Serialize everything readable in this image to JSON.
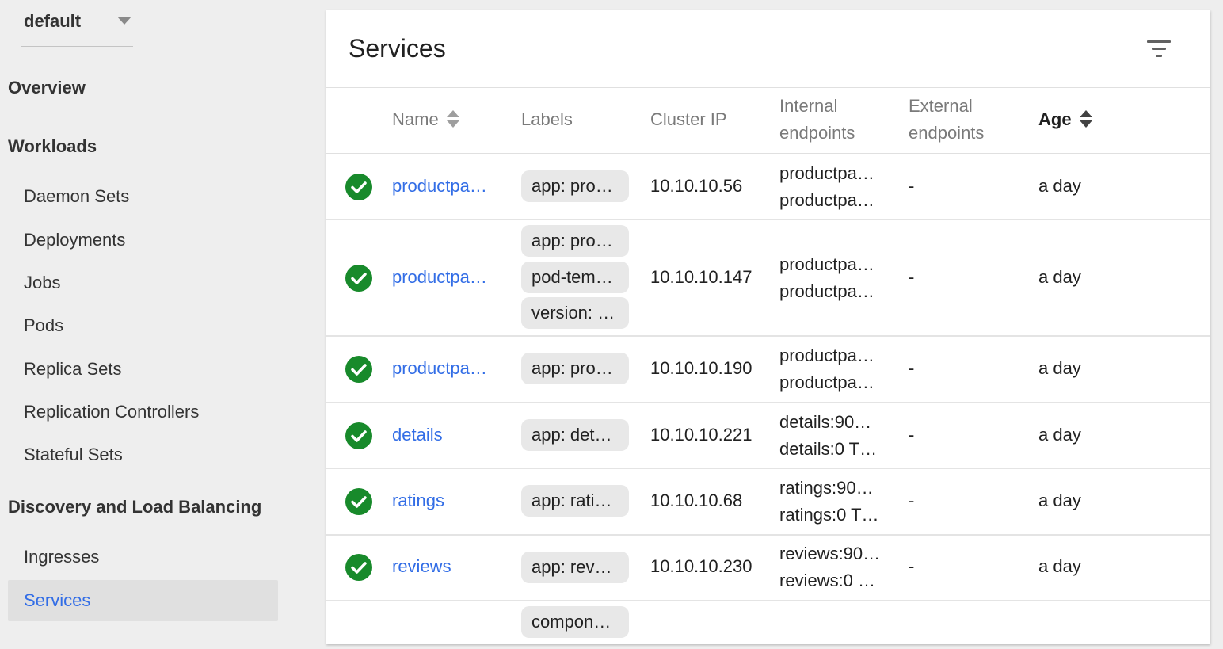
{
  "namespace": {
    "selected": "default"
  },
  "nav": {
    "overview": "Overview",
    "workloads": "Workloads",
    "workload_items": [
      "Daemon Sets",
      "Deployments",
      "Jobs",
      "Pods",
      "Replica Sets",
      "Replication Controllers",
      "Stateful Sets"
    ],
    "discovery": "Discovery and Load Balancing",
    "discovery_items": [
      "Ingresses",
      "Services"
    ]
  },
  "card": {
    "title": "Services",
    "filter_icon": "filter-list-icon"
  },
  "columns": {
    "name": "Name",
    "labels": "Labels",
    "cluster_ip": "Cluster IP",
    "internal_1": "Internal",
    "internal_2": "endpoints",
    "external_1": "External",
    "external_2": "endpoints",
    "age": "Age"
  },
  "rows": [
    {
      "status": "ok",
      "name": "productpa…",
      "labels": [
        "app: pro…"
      ],
      "cluster_ip": "10.10.10.56",
      "internal": [
        "productpa…",
        "productpa…"
      ],
      "external": "-",
      "age": "a day"
    },
    {
      "status": "ok",
      "name": "productpa…",
      "labels": [
        "app: pro…",
        "pod-tem…",
        "version: …"
      ],
      "cluster_ip": "10.10.10.147",
      "internal": [
        "productpa…",
        "productpa…"
      ],
      "external": "-",
      "age": "a day"
    },
    {
      "status": "ok",
      "name": "productpa…",
      "labels": [
        "app: pro…"
      ],
      "cluster_ip": "10.10.10.190",
      "internal": [
        "productpa…",
        "productpa…"
      ],
      "external": "-",
      "age": "a day"
    },
    {
      "status": "ok",
      "name": "details",
      "labels": [
        "app: det…"
      ],
      "cluster_ip": "10.10.10.221",
      "internal": [
        "details:90…",
        "details:0 T…"
      ],
      "external": "-",
      "age": "a day"
    },
    {
      "status": "ok",
      "name": "ratings",
      "labels": [
        "app: rati…"
      ],
      "cluster_ip": "10.10.10.68",
      "internal": [
        "ratings:90…",
        "ratings:0 T…"
      ],
      "external": "-",
      "age": "a day"
    },
    {
      "status": "ok",
      "name": "reviews",
      "labels": [
        "app: rev…"
      ],
      "cluster_ip": "10.10.10.230",
      "internal": [
        "reviews:90…",
        "reviews:0 …"
      ],
      "external": "-",
      "age": "a day"
    },
    {
      "status": "",
      "name": "",
      "labels": [
        "compon…"
      ],
      "cluster_ip": "",
      "internal": [],
      "external": "",
      "age": ""
    }
  ],
  "colors": {
    "accent": "#326de6",
    "ok": "#188a2b"
  }
}
